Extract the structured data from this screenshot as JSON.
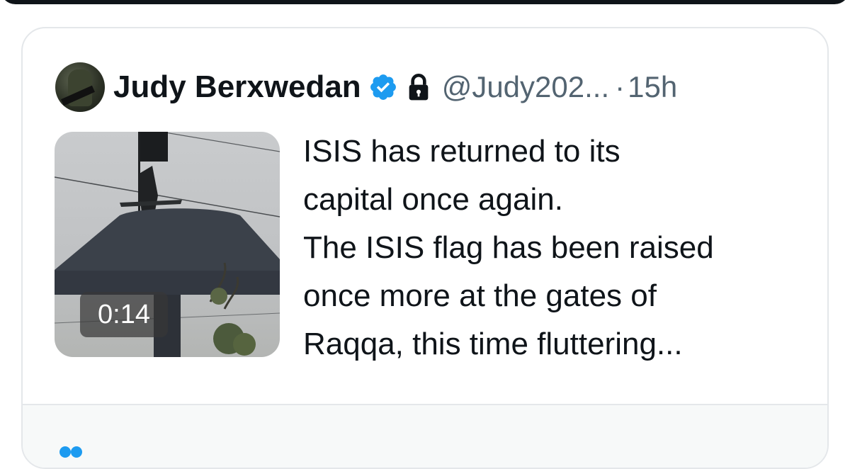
{
  "colors": {
    "text_primary": "#0f1419",
    "text_secondary": "#536471",
    "verified_blue": "#1d9bf0",
    "card_border": "#e4e7ea",
    "footer_bg": "#f7f9f9"
  },
  "quote_tweet": {
    "author": {
      "display_name": "Judy Berxwedan",
      "handle": "@Judy202...",
      "verified_icon": "verified-badge-icon",
      "protected_icon": "lock-icon"
    },
    "separator": "·",
    "timestamp": "15h",
    "media": {
      "type": "video",
      "duration": "0:14"
    },
    "text_lines": [
      "ISIS has returned to its",
      "capital once again.",
      "The ISIS flag has been raised",
      "once more at the gates of",
      "Raqqa, this time fluttering..."
    ]
  },
  "footer": {
    "icon": "people-icon"
  }
}
